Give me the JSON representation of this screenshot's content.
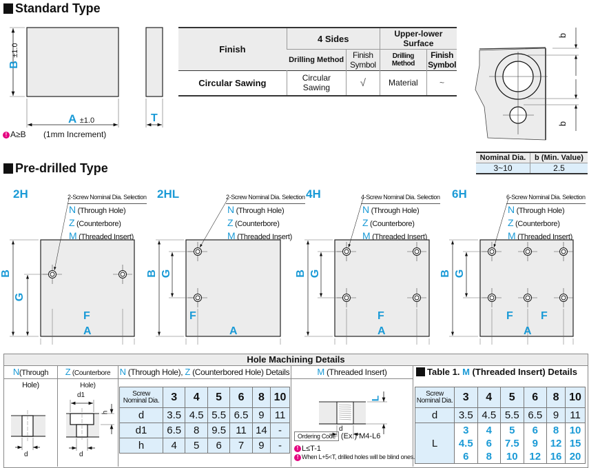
{
  "standard": {
    "title": "Standard Type",
    "dim_B": "B",
    "dim_B_tol": "±1.0",
    "dim_A": "A",
    "dim_A_tol": "±1.0",
    "dim_T": "T",
    "note_tip_icon": "!",
    "note_condition": "A≥B",
    "note_increment": "(1mm Increment)"
  },
  "finish_table": {
    "finish_header": "Finish",
    "group1": "4 Sides",
    "group2": "Upper-lower Surface",
    "sub_drilling1": "Drilling Method",
    "sub_symbol1": "Finish Symbol",
    "sub_drilling2": "Drilling Method",
    "sub_symbol2": "Finish Symbol",
    "row_label": "Circular Sawing",
    "row_drill1": "Circular Sawing",
    "row_symbol1": "√",
    "row_drill2": "Material",
    "row_symbol2": "~"
  },
  "b_diagram": {
    "label_top": "b",
    "label_bottom": "b"
  },
  "b_table": {
    "header_nominal": "Nominal Dia.",
    "header_b": "b (Min. Value)",
    "nominal": "3~10",
    "b": "2.5"
  },
  "predrilled": {
    "title": "Pre-drilled Type",
    "options": [
      {
        "code": "N",
        "desc": "(Through Hole)"
      },
      {
        "code": "Z",
        "desc": "(Counterbore)"
      },
      {
        "code": "M",
        "desc": "(Threaded Insert)"
      }
    ],
    "types": [
      {
        "name": "2H",
        "selection": "2-Screw Nominal Dia. Selection",
        "dims": [
          "B",
          "G",
          "F",
          "A"
        ]
      },
      {
        "name": "2HL",
        "selection": "2-Screw Nominal Dia. Selection",
        "dims": [
          "B",
          "G",
          "F",
          "A"
        ]
      },
      {
        "name": "4H",
        "selection": "4-Screw Nominal Dia. Selection",
        "dims": [
          "B",
          "G",
          "F",
          "A"
        ]
      },
      {
        "name": "6H",
        "selection": "6-Screw Nominal Dia. Selection",
        "dims": [
          "B",
          "G",
          "F",
          "F",
          "A"
        ]
      }
    ]
  },
  "hole_details": {
    "title": "Hole Machining Details",
    "col_n_code": "N",
    "col_n_desc": "(Through Hole)",
    "col_z_code": "Z",
    "col_z_desc": "(Counterbore Hole)",
    "col_nz_n": "N",
    "col_nz_mid": "(Through Hole),",
    "col_nz_z": "Z",
    "col_nz_desc": "(Counterbored Hole) Details",
    "col_m_code": "M",
    "col_m_desc": "(Threaded Insert)",
    "diagram_d": "d",
    "diagram_d1": "d1",
    "diagram_h": "h",
    "diagram_L": "L",
    "nz_table": {
      "header_label": "Screw Nominal Dia.",
      "sizes": [
        "3",
        "4",
        "5",
        "6",
        "8",
        "10"
      ],
      "rows": [
        {
          "label": "d",
          "values": [
            "3.5",
            "4.5",
            "5.5",
            "6.5",
            "9",
            "11"
          ]
        },
        {
          "label": "d1",
          "values": [
            "6.5",
            "8",
            "9.5",
            "11",
            "14",
            "-"
          ]
        },
        {
          "label": "h",
          "values": [
            "4",
            "5",
            "6",
            "7",
            "9",
            "-"
          ]
        }
      ]
    },
    "ordering_code_label": "Ordering Code",
    "ordering_example": "(Ex.) M4-L6",
    "note1": "L≤T-1",
    "note2": "When L+5<T, drilled holes will be blind ones.",
    "table1": {
      "title_prefix": "Table 1.",
      "title_code": "M",
      "title_suffix": "(Threaded Insert) Details",
      "header_label": "Screw Nominal Dia.",
      "sizes": [
        "3",
        "4",
        "5",
        "6",
        "8",
        "10"
      ],
      "d_label": "d",
      "d_values": [
        "3.5",
        "4.5",
        "5.5",
        "6.5",
        "9",
        "11"
      ],
      "L_label": "L",
      "L_values": [
        [
          "3",
          "4.5",
          "6"
        ],
        [
          "4",
          "6",
          "8"
        ],
        [
          "5",
          "7.5",
          "10"
        ],
        [
          "6",
          "9",
          "12"
        ],
        [
          "8",
          "12",
          "16"
        ],
        [
          "10",
          "15",
          "20"
        ]
      ]
    }
  }
}
